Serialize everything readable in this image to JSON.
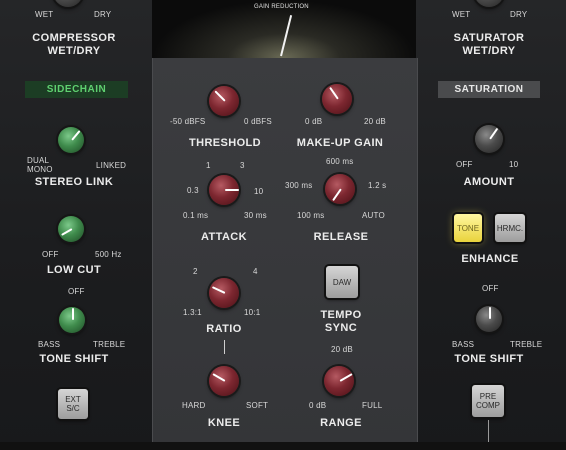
{
  "gain_reduction_label": "GAIN REDUCTION",
  "wet_dry_left": {
    "wet": "WET",
    "dry": "DRY",
    "title_line1": "COMPRESSOR",
    "title_line2": "WET/DRY"
  },
  "wet_dry_right": {
    "wet": "WET",
    "dry": "DRY",
    "title_line1": "SATURATOR",
    "title_line2": "WET/DRY"
  },
  "sidechain": {
    "header": "SIDECHAIN",
    "stereo_link": {
      "title": "STEREO LINK",
      "min_line1": "DUAL",
      "min_line2": "MONO",
      "max": "LINKED"
    },
    "low_cut": {
      "title": "LOW CUT",
      "min": "OFF",
      "max": "500 Hz"
    },
    "tone_shift": {
      "title": "TONE SHIFT",
      "top": "OFF",
      "min": "BASS",
      "max": "TREBLE"
    },
    "ext_sc": {
      "line1": "EXT",
      "line2": "S/C"
    }
  },
  "compressor": {
    "threshold": {
      "title": "THRESHOLD",
      "min": "-50 dBFS",
      "max": "0 dBFS"
    },
    "makeup": {
      "title": "MAKE-UP GAIN",
      "min": "0 dB",
      "max": "20 dB"
    },
    "attack": {
      "title": "ATTACK",
      "ticks": [
        "1",
        "3",
        "0.3",
        "10",
        "0.1 ms",
        "30 ms"
      ]
    },
    "release": {
      "title": "RELEASE",
      "ticks": [
        "600 ms",
        "300 ms",
        "1.2 s",
        "100 ms",
        "AUTO"
      ]
    },
    "ratio": {
      "title": "RATIO",
      "ticks": [
        "2",
        "4",
        "1.3:1",
        "10:1"
      ]
    },
    "tempo_sync": {
      "button": "DAW",
      "title_line1": "TEMPO",
      "title_line2": "SYNC"
    },
    "knee": {
      "title": "KNEE",
      "min": "HARD",
      "max": "SOFT"
    },
    "range": {
      "title": "RANGE",
      "top": "20 dB",
      "min": "0 dB",
      "max": "FULL"
    }
  },
  "saturation": {
    "header": "SATURATION",
    "amount": {
      "title": "AMOUNT",
      "min": "OFF",
      "max": "10"
    },
    "enhance": {
      "title": "ENHANCE",
      "tone": "TONE",
      "hrmc": "HRMC."
    },
    "tone_shift": {
      "title": "TONE SHIFT",
      "top": "OFF",
      "min": "BASS",
      "max": "TREBLE"
    },
    "pre_comp": {
      "line1": "PRE",
      "line2": "COMP"
    }
  },
  "colors": {
    "knob_red": "#7d2730",
    "knob_green": "#3f8b4c",
    "sidechain_header_text": "#5fd070",
    "enhance_active": "#e9d33c"
  }
}
